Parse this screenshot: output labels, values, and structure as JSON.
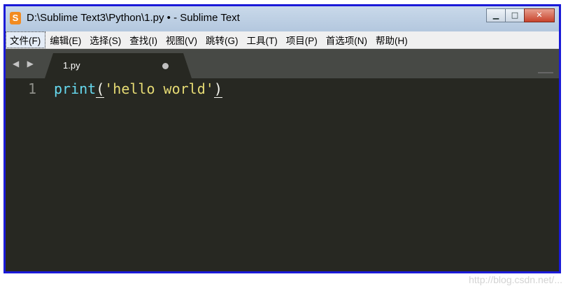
{
  "window": {
    "title": "D:\\Sublime Text3\\Python\\1.py • - Sublime Text",
    "app_icon": "S",
    "minimize": "▁",
    "maximize": "□",
    "close": "✕"
  },
  "menu": [
    "文件(F)",
    "编辑(E)",
    "选择(S)",
    "查找(I)",
    "视图(V)",
    "跳转(G)",
    "工具(T)",
    "项目(P)",
    "首选项(N)",
    "帮助(H)"
  ],
  "tabs": {
    "nav": "◀ ▶",
    "active": {
      "label": "1.py",
      "unsaved_indicator": "•"
    }
  },
  "editor": {
    "line_number": "1",
    "tokens": {
      "fn": "print",
      "open": "(",
      "str": "'hello world'",
      "close": ")"
    }
  },
  "watermark": "http://blog.csdn.net/...",
  "colors": {
    "editor_bg": "#272822",
    "fn": "#66d9ef",
    "string": "#e6db74",
    "frame_border": "#1a1ad8"
  }
}
